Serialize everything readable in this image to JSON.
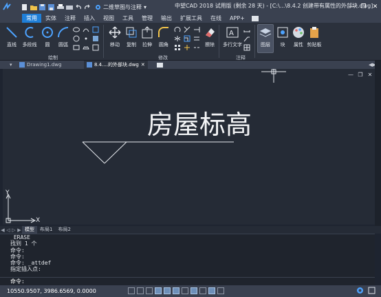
{
  "titlebar": {
    "workspace": "二维草图与注释",
    "title": "中望CAD 2018 试用版 (剩余 28 天) - [C:\\...\\8.4.2  创建带有属性的外部块.dwg]",
    "minimize": "—",
    "restore": "❐",
    "close": "✕"
  },
  "ribbon_tabs": [
    "常用",
    "实体",
    "注释",
    "插入",
    "视图",
    "工具",
    "管理",
    "输出",
    "扩展工具",
    "在线",
    "APP+"
  ],
  "ribbon": {
    "draw": {
      "label": "绘制",
      "line": "直线",
      "polyline": "多段线",
      "circle": "圆",
      "arc": "圆弧"
    },
    "modify": {
      "label": "修改",
      "move": "移动",
      "copy": "复制",
      "stretch": "拉伸",
      "fillet": "圆角",
      "erase": "擦除"
    },
    "annotation": {
      "label": "注释",
      "mtext": "多行文字"
    },
    "layers": "图层",
    "block": "块",
    "properties": "属性",
    "clipboard": "剪贴板"
  },
  "doc_tabs": {
    "tab1": "Drawing1.dwg",
    "tab2": "8.4....的外部块.dwg"
  },
  "canvas": {
    "text": "房屋标高",
    "y_axis": "Y",
    "x_axis": "X"
  },
  "layout_tabs": [
    "模型",
    "布局1",
    "布局2"
  ],
  "command_history": [
    "_ERASE",
    "找到 1 个",
    "命令:",
    "命令:",
    "命令: _attdef",
    "指定插入点:"
  ],
  "command_prompt": "命令:",
  "status": {
    "coords": "10550.9507, 3986.6569, 0.0000"
  }
}
